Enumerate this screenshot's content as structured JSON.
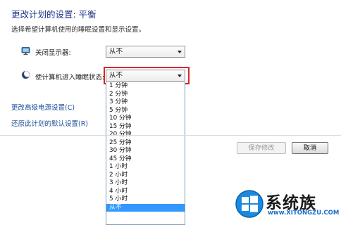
{
  "header": {
    "title": "更改计划的设置: 平衡",
    "subtitle": "选择希望计算机使用的睡眠设置和显示设置。"
  },
  "settings": {
    "display": {
      "label": "关闭显示器:",
      "value": "从不"
    },
    "sleep": {
      "label": "使计算机进入睡眠状态:",
      "value": "从不"
    }
  },
  "dropdown": {
    "options": [
      "1 分钟",
      "2 分钟",
      "3 分钟",
      "5 分钟",
      "10 分钟",
      "15 分钟",
      "20 分钟",
      "25 分钟",
      "30 分钟",
      "45 分钟",
      "1 小时",
      "2 小时",
      "3 小时",
      "4 小时",
      "5 小时",
      "从不"
    ],
    "selected_index": 15
  },
  "links": {
    "advanced": "更改高级电源设置(C)",
    "restore": "还原此计划的默认设置(R)"
  },
  "buttons": {
    "save": "保存修改",
    "cancel": "取消"
  },
  "watermark": {
    "brand": "系统族",
    "url": "www.XITONGZU.COM"
  },
  "colors": {
    "title": "#1e3287",
    "link": "#1e4f9c",
    "highlight_box": "#d9262b",
    "selected_option": "#3399ff"
  },
  "icons": {
    "display": "monitor-icon",
    "sleep": "moon-icon",
    "dropdown": "chevron-down-icon",
    "logo": "windows-logo-icon"
  }
}
